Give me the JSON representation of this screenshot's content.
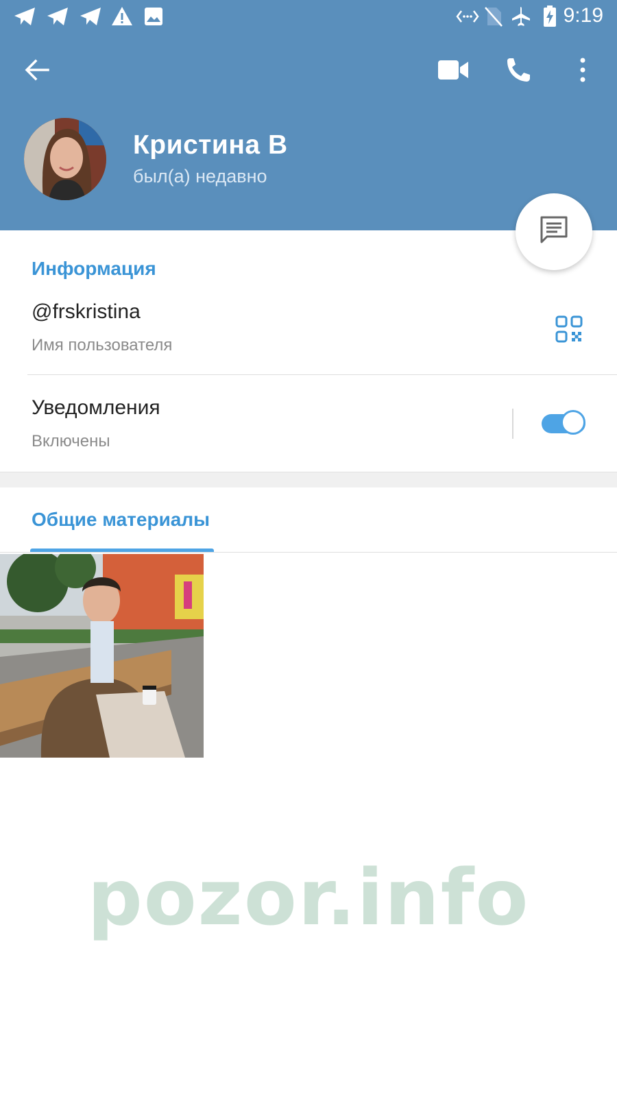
{
  "status_bar": {
    "notification_icons": [
      "telegram-icon",
      "telegram-icon",
      "telegram-icon",
      "warning-icon",
      "image-icon"
    ],
    "system_icons": [
      "data-saver-icon",
      "no-sim-icon",
      "airplane-mode-icon",
      "battery-charging-icon"
    ],
    "time": "9:19"
  },
  "toolbar": {
    "back_icon": "arrow-left-icon",
    "video_call_icon": "video-camera-icon",
    "voice_call_icon": "phone-icon",
    "menu_icon": "more-vertical-icon"
  },
  "profile": {
    "name": "Кристина В",
    "status": "был(а) недавно"
  },
  "info": {
    "title": "Информация",
    "username": "@frskristina",
    "username_label": "Имя пользователя",
    "notifications_label": "Уведомления",
    "notifications_status": "Включены",
    "notifications_enabled": true
  },
  "shared_media": {
    "tab_label": "Общие материалы"
  },
  "watermark": "pozor.info",
  "colors": {
    "header": "#5a8fbc",
    "accent": "#3a94d6",
    "toggle": "#4ea4e5",
    "watermark": "#cde1d6"
  }
}
